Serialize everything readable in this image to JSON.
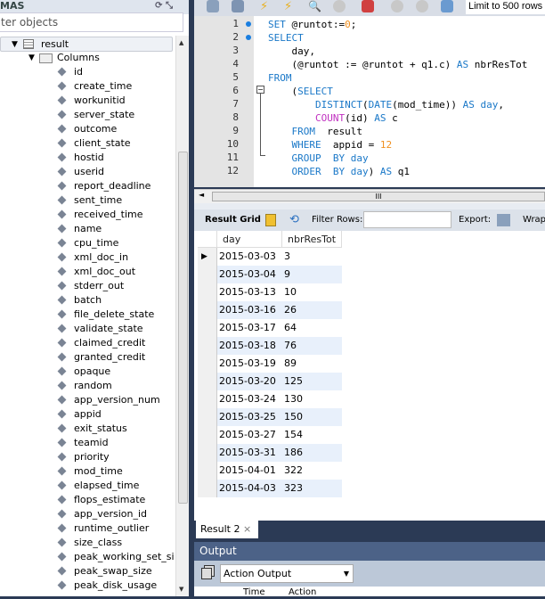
{
  "sidebar": {
    "header": "MAS",
    "filter_placeholder": "ter objects",
    "table": "result",
    "folder": "Columns",
    "columns": [
      "id",
      "create_time",
      "workunitid",
      "server_state",
      "outcome",
      "client_state",
      "hostid",
      "userid",
      "report_deadline",
      "sent_time",
      "received_time",
      "name",
      "cpu_time",
      "xml_doc_in",
      "xml_doc_out",
      "stderr_out",
      "batch",
      "file_delete_state",
      "validate_state",
      "claimed_credit",
      "granted_credit",
      "opaque",
      "random",
      "app_version_num",
      "appid",
      "exit_status",
      "teamid",
      "priority",
      "mod_time",
      "elapsed_time",
      "flops_estimate",
      "app_version_id",
      "runtime_outlier",
      "size_class",
      "peak_working_set_size",
      "peak_swap_size",
      "peak_disk_usage"
    ]
  },
  "toolbar": {
    "limit": "Limit to 500 rows"
  },
  "editor": {
    "line_numbers": [
      "1",
      "2",
      "3",
      "4",
      "5",
      "6",
      "7",
      "8",
      "9",
      "10",
      "11",
      "12"
    ]
  },
  "result_toolbar": {
    "grid": "Result Grid",
    "filter": "Filter Rows:",
    "export": "Export:",
    "wrap": "Wrap"
  },
  "grid": {
    "headers": [
      "day",
      "nbrResTot"
    ],
    "rows": [
      [
        "2015-03-03",
        "3"
      ],
      [
        "2015-03-04",
        "9"
      ],
      [
        "2015-03-13",
        "10"
      ],
      [
        "2015-03-16",
        "26"
      ],
      [
        "2015-03-17",
        "64"
      ],
      [
        "2015-03-18",
        "76"
      ],
      [
        "2015-03-19",
        "89"
      ],
      [
        "2015-03-20",
        "125"
      ],
      [
        "2015-03-24",
        "130"
      ],
      [
        "2015-03-25",
        "150"
      ],
      [
        "2015-03-27",
        "154"
      ],
      [
        "2015-03-31",
        "186"
      ],
      [
        "2015-04-01",
        "322"
      ],
      [
        "2015-04-03",
        "323"
      ]
    ]
  },
  "tabs": {
    "result": "Result 2",
    "close": "×"
  },
  "output": {
    "title": "Output",
    "select": "Action Output",
    "col_time": "Time",
    "col_action": "Action"
  }
}
